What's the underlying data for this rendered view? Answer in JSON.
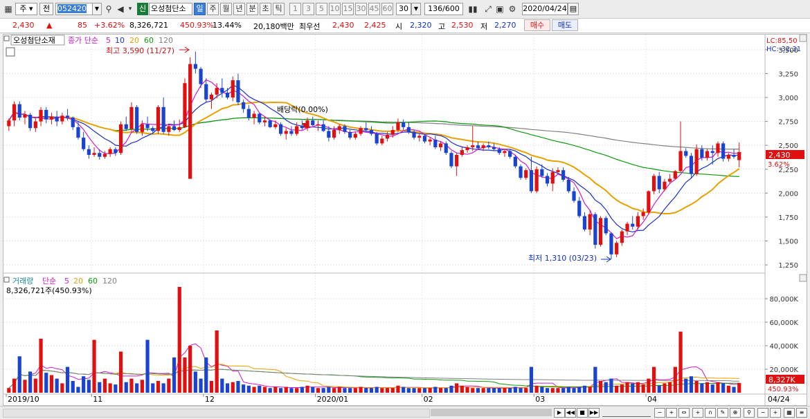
{
  "toolbar": {
    "period_type": "주",
    "prev_label": "전",
    "code": "052420",
    "stock_badge": "신",
    "stock_name": "오성첨단소",
    "timeframes": [
      "일",
      "주",
      "월",
      "년",
      "분",
      "초",
      "틱"
    ],
    "active_timeframe": "일",
    "intervals": [
      "1",
      "3",
      "5",
      "10",
      "15",
      "30",
      "45",
      "60"
    ],
    "count_value": "30",
    "range": "136/600",
    "date": "2020/04/24"
  },
  "info_bar": {
    "price": "2,430",
    "change_sign": "▲",
    "change": "85",
    "change_pct": "+3.62%",
    "volume": "8,326,721",
    "volume_pct": "450.93%",
    "turnover": "13.44%",
    "amount": "20,180백만",
    "best_label": "최우선",
    "ask": "2,430",
    "bid": "2,425",
    "open_label": "시",
    "open": "2,320",
    "high_label": "고",
    "high": "2,530",
    "low_label": "저",
    "low": "2,270",
    "buy_label": "매수",
    "sell_label": "매도"
  },
  "price_chart": {
    "legend_name": "오성첨단소재",
    "legend_ma_label": "종가 단순",
    "ma_periods": [
      "5",
      "10",
      "20",
      "60",
      "120"
    ],
    "ma_colors": [
      "#d01ad0",
      "#1a30c8",
      "#e8a000",
      "#0a9a0a",
      "#808080"
    ],
    "lc_label": "LC:85,50",
    "hc_label": "HC:-32,31",
    "high_annotation": "최고 3,590 (11/27)",
    "low_annotation": "최저 1,310 (03/23)",
    "dividend_annotation": "배당락(0.00%)",
    "current_price_tag": "2,430",
    "current_pct_tag": "3.62%",
    "y_ticks": [
      "3,500",
      "3,250",
      "3,000",
      "2,750",
      "2,500",
      "2,250",
      "2,000",
      "1,750",
      "1,500",
      "1,250"
    ]
  },
  "volume_chart": {
    "legend_name": "거래량",
    "legend_ma_label": "단순",
    "ma_periods": [
      "5",
      "20",
      "60",
      "120"
    ],
    "current_volume": "8,326,721주(450.93%)",
    "current_tag": "8,327K",
    "current_pct_tag": "450.93%",
    "y_ticks": [
      "80,000K",
      "60,000K",
      "40,000K",
      "20,000K"
    ]
  },
  "x_axis": {
    "labels": [
      "2019/10",
      "11",
      "12",
      "2020/01",
      "02",
      "03",
      "04"
    ],
    "right_label": "04/24"
  },
  "chart_data": {
    "type": "candlestick",
    "price_range": [
      1200,
      3600
    ],
    "volume_range": [
      0,
      90000
    ],
    "candles": [
      [
        2700,
        2780,
        2650,
        2760,
        4000
      ],
      [
        2760,
        2960,
        2700,
        2930,
        12000
      ],
      [
        2930,
        2960,
        2760,
        2790,
        31000
      ],
      [
        2790,
        2860,
        2720,
        2820,
        11000
      ],
      [
        2820,
        2840,
        2650,
        2680,
        18000
      ],
      [
        2680,
        2780,
        2640,
        2750,
        12000
      ],
      [
        2750,
        2900,
        2700,
        2870,
        46000
      ],
      [
        2870,
        2900,
        2730,
        2770,
        17000
      ],
      [
        2770,
        2840,
        2720,
        2800,
        15000
      ],
      [
        2800,
        2860,
        2700,
        2750,
        12000
      ],
      [
        2750,
        2840,
        2720,
        2810,
        8000
      ],
      [
        2810,
        2880,
        2760,
        2790,
        22000
      ],
      [
        2790,
        2800,
        2660,
        2690,
        10000
      ],
      [
        2690,
        2750,
        2560,
        2580,
        5000
      ],
      [
        2580,
        2640,
        2440,
        2460,
        14000
      ],
      [
        2460,
        2500,
        2360,
        2400,
        11000
      ],
      [
        2400,
        2480,
        2380,
        2420,
        45000
      ],
      [
        2420,
        2460,
        2350,
        2380,
        9000
      ],
      [
        2380,
        2440,
        2360,
        2410,
        12000
      ],
      [
        2410,
        2480,
        2380,
        2460,
        8000
      ],
      [
        2460,
        2480,
        2390,
        2420,
        7000
      ],
      [
        2420,
        2750,
        2400,
        2720,
        35000
      ],
      [
        2720,
        2800,
        2650,
        2670,
        9000
      ],
      [
        2670,
        2950,
        2640,
        2900,
        12000
      ],
      [
        2900,
        2920,
        2620,
        2640,
        8000
      ],
      [
        2640,
        2760,
        2600,
        2720,
        11000
      ],
      [
        2720,
        2800,
        2650,
        2680,
        45000
      ],
      [
        2680,
        2700,
        2620,
        2650,
        8000
      ],
      [
        2650,
        2920,
        2620,
        2900,
        10000
      ],
      [
        2900,
        3000,
        2620,
        2640,
        8000
      ],
      [
        2640,
        2720,
        2600,
        2700,
        12000
      ],
      [
        2700,
        2760,
        2650,
        2660,
        30000
      ],
      [
        2660,
        2770,
        2640,
        2690,
        90000
      ],
      [
        2690,
        3200,
        2680,
        3150,
        30000
      ],
      [
        2150,
        3420,
        3100,
        3350,
        40000
      ],
      [
        3350,
        3480,
        3250,
        3300,
        18000
      ],
      [
        3300,
        3320,
        3100,
        3140,
        12000
      ],
      [
        3140,
        3200,
        2950,
        2980,
        30000
      ],
      [
        2980,
        3050,
        2880,
        3030,
        10000
      ],
      [
        3030,
        3150,
        2990,
        3100,
        53000
      ],
      [
        3100,
        3200,
        3000,
        3050,
        12000
      ],
      [
        3050,
        3100,
        2980,
        3000,
        8000
      ],
      [
        3000,
        3220,
        2960,
        3180,
        9000
      ],
      [
        3180,
        3250,
        2920,
        2950,
        10000
      ],
      [
        2950,
        2980,
        2840,
        2880,
        7000
      ],
      [
        2880,
        2920,
        2760,
        2790,
        6000
      ],
      [
        2790,
        2860,
        2720,
        2830,
        5000
      ],
      [
        2830,
        2840,
        2720,
        2740,
        6000
      ],
      [
        2740,
        2800,
        2700,
        2760,
        5000
      ],
      [
        2760,
        2770,
        2680,
        2690,
        4000
      ],
      [
        2690,
        2760,
        2670,
        2720,
        5000
      ],
      [
        2720,
        2740,
        2600,
        2620,
        4000
      ],
      [
        2620,
        2680,
        2560,
        2650,
        5000
      ],
      [
        2650,
        2700,
        2600,
        2620,
        4000
      ],
      [
        2620,
        2740,
        2600,
        2700,
        4000
      ],
      [
        2700,
        2760,
        2660,
        2680,
        5000
      ],
      [
        2680,
        2790,
        2650,
        2760,
        6000
      ],
      [
        2760,
        2800,
        2700,
        2710,
        5000
      ],
      [
        2710,
        2760,
        2650,
        2720,
        4000
      ],
      [
        2720,
        2760,
        2640,
        2650,
        4000
      ],
      [
        2650,
        2700,
        2540,
        2580,
        5000
      ],
      [
        2580,
        2700,
        2560,
        2660,
        4000
      ],
      [
        2660,
        2720,
        2620,
        2700,
        5000
      ],
      [
        2700,
        2720,
        2620,
        2640,
        4000
      ],
      [
        2640,
        2660,
        2560,
        2580,
        4000
      ],
      [
        2580,
        2640,
        2560,
        2620,
        4000
      ],
      [
        2620,
        2700,
        2600,
        2680,
        5000
      ],
      [
        2680,
        2740,
        2640,
        2660,
        4000
      ],
      [
        2660,
        2700,
        2600,
        2620,
        4000
      ],
      [
        2620,
        2640,
        2500,
        2520,
        5000
      ],
      [
        2520,
        2600,
        2500,
        2570,
        4000
      ],
      [
        2570,
        2640,
        2540,
        2610,
        4000
      ],
      [
        2610,
        2700,
        2580,
        2660,
        4000
      ],
      [
        2660,
        2780,
        2640,
        2740,
        6000
      ],
      [
        2740,
        2770,
        2660,
        2690,
        5000
      ],
      [
        2690,
        2740,
        2620,
        2640,
        4000
      ],
      [
        2640,
        2660,
        2560,
        2580,
        4000
      ],
      [
        2580,
        2620,
        2540,
        2600,
        4000
      ],
      [
        2600,
        2620,
        2520,
        2540,
        4000
      ],
      [
        2540,
        2580,
        2500,
        2560,
        4000
      ],
      [
        2560,
        2600,
        2460,
        2480,
        5000
      ],
      [
        2480,
        2540,
        2440,
        2520,
        4000
      ],
      [
        2520,
        2540,
        2400,
        2420,
        4000
      ],
      [
        2420,
        2440,
        2260,
        2280,
        6000
      ],
      [
        2280,
        2420,
        2180,
        2400,
        8000
      ],
      [
        2400,
        2480,
        2380,
        2450,
        6000
      ],
      [
        2450,
        2500,
        2420,
        2480,
        5000
      ],
      [
        2480,
        2700,
        2440,
        2500,
        4000
      ],
      [
        2500,
        2540,
        2460,
        2470,
        4000
      ],
      [
        2470,
        2520,
        2440,
        2500,
        4000
      ],
      [
        2500,
        2540,
        2460,
        2480,
        4000
      ],
      [
        2480,
        2520,
        2440,
        2460,
        4000
      ],
      [
        2460,
        2480,
        2400,
        2420,
        4000
      ],
      [
        2420,
        2460,
        2380,
        2440,
        4000
      ],
      [
        2440,
        2460,
        2360,
        2380,
        4000
      ],
      [
        2380,
        2400,
        2260,
        2280,
        5000
      ],
      [
        2280,
        2300,
        2140,
        2160,
        4000
      ],
      [
        2160,
        2260,
        2140,
        2240,
        4000
      ],
      [
        2240,
        2380,
        2000,
        2020,
        22000
      ],
      [
        2020,
        2280,
        2000,
        2250,
        6000
      ],
      [
        2250,
        2300,
        2160,
        2180,
        5000
      ],
      [
        2180,
        2210,
        2070,
        2100,
        4000
      ],
      [
        2100,
        2260,
        2020,
        2220,
        4000
      ],
      [
        2220,
        2270,
        2200,
        2240,
        4000
      ],
      [
        2240,
        2270,
        2120,
        2140,
        4000
      ],
      [
        2140,
        2170,
        2000,
        2020,
        5000
      ],
      [
        2020,
        2060,
        1900,
        1920,
        4000
      ],
      [
        1920,
        1960,
        1740,
        1760,
        5000
      ],
      [
        1760,
        1800,
        1600,
        1620,
        6000
      ],
      [
        1620,
        1820,
        1560,
        1780,
        5000
      ],
      [
        1780,
        1800,
        1420,
        1460,
        22000
      ],
      [
        1460,
        1760,
        1440,
        1740,
        10000
      ],
      [
        1740,
        1760,
        1560,
        1580,
        9000
      ],
      [
        1580,
        1590,
        1310,
        1360,
        12000
      ],
      [
        1360,
        1500,
        1330,
        1480,
        6000
      ],
      [
        1480,
        1620,
        1450,
        1600,
        7000
      ],
      [
        1600,
        1700,
        1560,
        1680,
        9000
      ],
      [
        1680,
        1760,
        1620,
        1650,
        8000
      ],
      [
        1650,
        1800,
        1620,
        1760,
        9000
      ],
      [
        1760,
        1840,
        1720,
        1800,
        7000
      ],
      [
        1800,
        2030,
        1780,
        2020,
        12000
      ],
      [
        2020,
        2200,
        1990,
        2180,
        22000
      ],
      [
        2180,
        2220,
        2000,
        2040,
        6000
      ],
      [
        2040,
        2150,
        2020,
        2120,
        8000
      ],
      [
        2120,
        2200,
        2100,
        2150,
        9000
      ],
      [
        2150,
        2240,
        2150,
        2230,
        22000
      ],
      [
        2230,
        2750,
        2220,
        2440,
        52000
      ],
      [
        2440,
        2470,
        2370,
        2390,
        12000
      ],
      [
        2390,
        2420,
        2160,
        2200,
        14000
      ],
      [
        2200,
        2510,
        2180,
        2460,
        10000
      ],
      [
        2460,
        2500,
        2340,
        2370,
        8000
      ],
      [
        2370,
        2460,
        2340,
        2440,
        9000
      ],
      [
        2440,
        2500,
        2300,
        2420,
        7000
      ],
      [
        2420,
        2540,
        2380,
        2520,
        9000
      ],
      [
        2520,
        2540,
        2330,
        2360,
        8000
      ],
      [
        2360,
        2420,
        2330,
        2400,
        6000
      ],
      [
        2400,
        2460,
        2360,
        2380,
        5000
      ],
      [
        2345,
        2530,
        2270,
        2430,
        8327
      ]
    ]
  }
}
